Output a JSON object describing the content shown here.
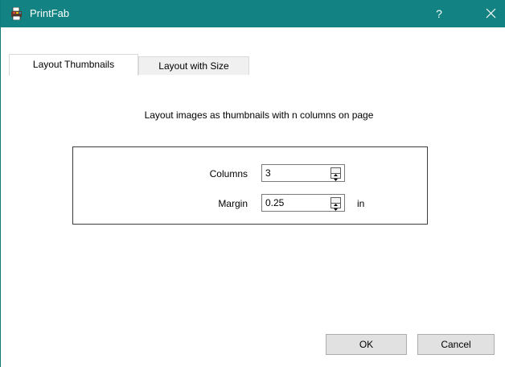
{
  "window": {
    "title": "PrintFab",
    "help_label": "?",
    "icon": "printfab-app-icon",
    "close_icon": "close-icon",
    "accent_color": "#128283"
  },
  "tabs": [
    {
      "label": "Layout Thumbnails",
      "active": true
    },
    {
      "label": "Layout with Size",
      "active": false
    }
  ],
  "panel": {
    "description": "Layout images as thumbnails with n columns on page",
    "fields": {
      "columns": {
        "label": "Columns",
        "value": "3"
      },
      "margin": {
        "label": "Margin",
        "value": "0.25",
        "unit": "in"
      }
    }
  },
  "buttons": {
    "ok_label": "OK",
    "cancel_label": "Cancel"
  }
}
